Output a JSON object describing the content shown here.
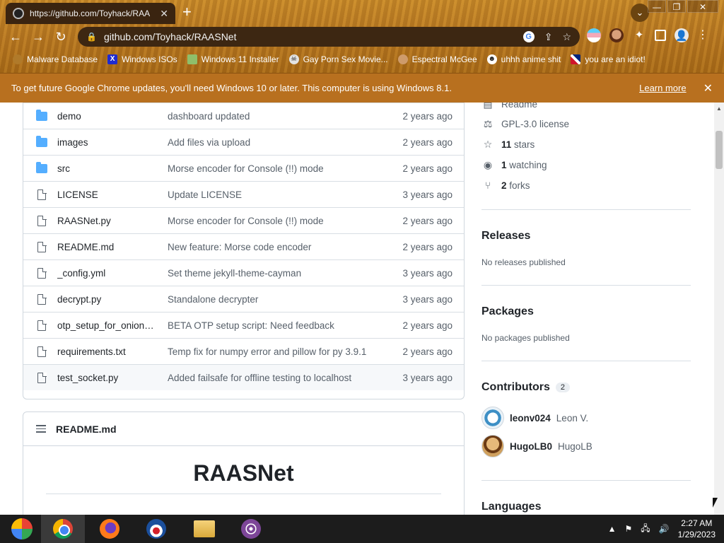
{
  "browser": {
    "tab_title": "https://github.com/Toyhack/RAA",
    "tab_close": "✕",
    "new_tab": "+",
    "menu_chevron": "⌄",
    "window_controls": {
      "minimize": "—",
      "restore": "❐",
      "close": "✕"
    },
    "nav": {
      "back": "←",
      "forward": "→",
      "reload": "↻"
    },
    "url": "github.com/Toyhack/RAASNet",
    "lock_icon": "🔒",
    "omnibox_icons": {
      "google": "G",
      "share": "⇪",
      "star": "☆"
    },
    "extensions": {
      "puzzle": "✦",
      "profile": "👤",
      "menu": "⋮"
    },
    "bookmarks": [
      {
        "label": "Malware Database",
        "icon": "dot-icon"
      },
      {
        "label": "Windows ISOs",
        "icon": "x-icon",
        "glyph": "X"
      },
      {
        "label": "Windows 11 Installer",
        "icon": "picture-icon"
      },
      {
        "label": "Gay Porn Sex Movie...",
        "icon": "skull-icon",
        "glyph": "☠"
      },
      {
        "label": "Espectral McGee",
        "icon": "face-icon"
      },
      {
        "label": "uhhh anime shit",
        "icon": "anime-icon",
        "glyph": "☻"
      },
      {
        "label": "you are an idiot!",
        "icon": "uk-flag-icon"
      }
    ],
    "infobar": {
      "message": "To get future Google Chrome updates, you'll need Windows 10 or later. This computer is using Windows 8.1.",
      "learn_more": "Learn more",
      "close": "✕"
    }
  },
  "files": [
    {
      "type": "folder",
      "name": "demo",
      "message": "dashboard updated",
      "age": "2 years ago"
    },
    {
      "type": "folder",
      "name": "images",
      "message": "Add files via upload",
      "age": "2 years ago"
    },
    {
      "type": "folder",
      "name": "src",
      "message": "Morse encoder for Console (!!) mode",
      "age": "2 years ago"
    },
    {
      "type": "file",
      "name": "LICENSE",
      "message": "Update LICENSE",
      "age": "3 years ago"
    },
    {
      "type": "file",
      "name": "RAASNet.py",
      "message": "Morse encoder for Console (!!) mode",
      "age": "2 years ago"
    },
    {
      "type": "file",
      "name": "README.md",
      "message": "New feature: Morse code encoder",
      "age": "2 years ago"
    },
    {
      "type": "file",
      "name": "_config.yml",
      "message": "Set theme jekyll-theme-cayman",
      "age": "3 years ago"
    },
    {
      "type": "file",
      "name": "decrypt.py",
      "message": "Standalone decrypter",
      "age": "3 years ago"
    },
    {
      "type": "file",
      "name": "otp_setup_for_onion_...",
      "message": "BETA OTP setup script: Need feedback",
      "age": "2 years ago"
    },
    {
      "type": "file",
      "name": "requirements.txt",
      "message": "Temp fix for numpy error and pillow for py 3.9.1",
      "age": "2 years ago"
    },
    {
      "type": "file",
      "name": "test_socket.py",
      "message": "Added failsafe for offline testing to localhost",
      "age": "3 years ago"
    }
  ],
  "readme": {
    "header": "README.md",
    "heading": "RAASNet"
  },
  "sidebar": {
    "about": {
      "readme": "Readme",
      "license": "GPL-3.0 license",
      "stars_count": "11",
      "stars_label": "stars",
      "watching_count": "1",
      "watching_label": "watching",
      "forks_count": "2",
      "forks_label": "forks"
    },
    "releases": {
      "title": "Releases",
      "text": "No releases published"
    },
    "packages": {
      "title": "Packages",
      "text": "No packages published"
    },
    "contributors": {
      "title": "Contributors",
      "count": "2",
      "people": [
        {
          "login": "leonv024",
          "name": "Leon V."
        },
        {
          "login": "HugoLB0",
          "name": "HugoLB"
        }
      ]
    },
    "languages": {
      "title": "Languages"
    }
  },
  "taskbar": {
    "clock_time": "2:27 AM",
    "clock_date": "1/29/2023",
    "tray": {
      "chevron": "▲",
      "flag": "⚑",
      "network": "🖧",
      "volume": "🔊"
    }
  }
}
